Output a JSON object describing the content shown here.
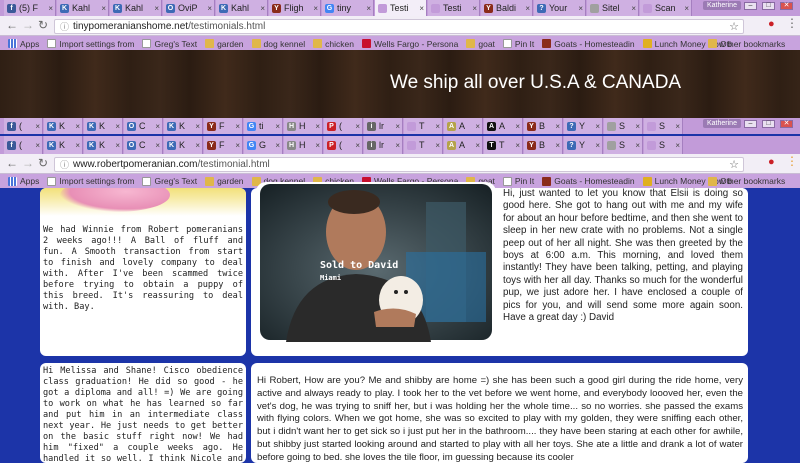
{
  "browser_top": {
    "tabs": [
      {
        "label": "(5) F",
        "color": "#3b5998",
        "glyph": "f"
      },
      {
        "label": "Kahl",
        "color": "#3d6ab5",
        "glyph": "K"
      },
      {
        "label": "Kahl",
        "color": "#3d6ab5",
        "glyph": "K"
      },
      {
        "label": "OviP",
        "color": "#3d6ab5",
        "glyph": "O"
      },
      {
        "label": "Kahl",
        "color": "#3d6ab5",
        "glyph": "K"
      },
      {
        "label": "Fligh",
        "color": "#8a2b1a",
        "glyph": "Y"
      },
      {
        "label": "tiny",
        "color": "#4285f4",
        "glyph": "G"
      },
      {
        "label": "Testi",
        "color": "#c29bd9",
        "glyph": ""
      },
      {
        "label": "Testi",
        "color": "#c29bd9",
        "glyph": ""
      },
      {
        "label": "Baldi",
        "color": "#8a2b1a",
        "glyph": "Y"
      },
      {
        "label": "Your",
        "color": "#3d6ab5",
        "glyph": "?"
      },
      {
        "label": "Sitel",
        "color": "#a0a0a0",
        "glyph": ""
      },
      {
        "label": "Scan",
        "color": "#c29bd9",
        "glyph": ""
      }
    ],
    "profile": "Katherine",
    "url_host": "tinypomeranianshome.net",
    "url_path": "/testimonials.html"
  },
  "browser_inner": {
    "tabs": [
      {
        "label": "( ",
        "color": "#3b5998",
        "glyph": "f"
      },
      {
        "label": "K",
        "color": "#3d6ab5",
        "glyph": "K"
      },
      {
        "label": "K",
        "color": "#3d6ab5",
        "glyph": "K"
      },
      {
        "label": "C",
        "color": "#3d6ab5",
        "glyph": "O"
      },
      {
        "label": "K",
        "color": "#3d6ab5",
        "glyph": "K"
      },
      {
        "label": "F",
        "color": "#8a2b1a",
        "glyph": "Y"
      },
      {
        "label": "ti",
        "color": "#4285f4",
        "glyph": "G"
      },
      {
        "label": "H",
        "color": "#888",
        "glyph": "H"
      },
      {
        "label": "(",
        "color": "#cb2027",
        "glyph": "P"
      },
      {
        "label": "lr",
        "color": "#666",
        "glyph": "i"
      },
      {
        "label": "T",
        "color": "#c29bd9",
        "glyph": ""
      },
      {
        "label": "A",
        "color": "#b5a34a",
        "glyph": "A"
      },
      {
        "label": "A",
        "color": "#111",
        "glyph": "A"
      },
      {
        "label": "B",
        "color": "#8a2b1a",
        "glyph": "Y"
      },
      {
        "label": "Y",
        "color": "#3d6ab5",
        "glyph": "?"
      },
      {
        "label": "S",
        "color": "#a0a0a0",
        "glyph": ""
      },
      {
        "label": "S",
        "color": "#c29bd9",
        "glyph": ""
      }
    ],
    "profile": "Katherine"
  },
  "browser_main": {
    "tabs": [
      {
        "label": "( ",
        "color": "#3b5998",
        "glyph": "f"
      },
      {
        "label": "K",
        "color": "#3d6ab5",
        "glyph": "K"
      },
      {
        "label": "K",
        "color": "#3d6ab5",
        "glyph": "K"
      },
      {
        "label": "C",
        "color": "#3d6ab5",
        "glyph": "O"
      },
      {
        "label": "K",
        "color": "#3d6ab5",
        "glyph": "K"
      },
      {
        "label": "F",
        "color": "#8a2b1a",
        "glyph": "Y"
      },
      {
        "label": "G",
        "color": "#4285f4",
        "glyph": "G"
      },
      {
        "label": "H",
        "color": "#888",
        "glyph": "H"
      },
      {
        "label": "(",
        "color": "#cb2027",
        "glyph": "P"
      },
      {
        "label": "lr",
        "color": "#666",
        "glyph": "i"
      },
      {
        "label": "T",
        "color": "#c29bd9",
        "glyph": ""
      },
      {
        "label": "A",
        "color": "#b5a34a",
        "glyph": "A"
      },
      {
        "label": "T",
        "color": "#111",
        "glyph": "T"
      },
      {
        "label": "B",
        "color": "#8a2b1a",
        "glyph": "Y"
      },
      {
        "label": "Y",
        "color": "#3d6ab5",
        "glyph": "?"
      },
      {
        "label": "S",
        "color": "#a0a0a0",
        "glyph": ""
      },
      {
        "label": "S",
        "color": "#c29bd9",
        "glyph": ""
      }
    ],
    "url_host": "www.robertpomeranian.com",
    "url_path": "/testimonial.html"
  },
  "bookmarks": [
    {
      "label": "Apps",
      "icon": "apps"
    },
    {
      "label": "Import settings from",
      "icon": "doc"
    },
    {
      "label": "Greg's Text",
      "icon": "doc"
    },
    {
      "label": "garden",
      "icon": "folder"
    },
    {
      "label": "dog kennel",
      "icon": "folder"
    },
    {
      "label": "chicken",
      "icon": "folder"
    },
    {
      "label": "Wells Fargo - Persona",
      "icon": "wf"
    },
    {
      "label": "goat",
      "icon": "folder"
    },
    {
      "label": "Pin It",
      "icon": "doc"
    },
    {
      "label": "Goats - Homesteadin",
      "icon": "y"
    },
    {
      "label": "Lunch Money Now b",
      "icon": "star"
    }
  ],
  "other_bookmarks": "Other bookmarks",
  "banner_text": "We ship all over U.S.A & CANADA",
  "testimonials": {
    "winnie": "We had Winnie from Robert pomeranians 2 weeks ago!!! A Ball of fluff and fun. A Smooth transaction from start to finish and lovely company to deal with. After I've been scammed twice before trying to obtain a puppy of this breed. It's reassuring to deal with. Bay.",
    "photo_caption": "Sold to David",
    "photo_location": "Miami",
    "elsii": "Hi, just wanted to let you know that Elsii is doing so good here. She got to hang out with me and my wife for about an hour before bedtime, and then she went to sleep in her new crate with no problems. Not a single peep out of her all night. She was then greeted by the boys at 6:00 a.m. This morning, and loved them instantly! They have been talking, petting, and playing toys with her all day. Thanks so much for the wonderful pup, we just adore her. I have enclosed a couple of pics for you, and will send some more again soon. Have a great day :) David",
    "cisco": "Hi Melissa and Shane! Cisco obedience class graduation! He did so good - he got a diploma and all! =) We are going to work on what he has learned so far and put him in an intermediate class next year. He just needs to get better on the basic stuff right now! We had him \"fixed\" a couple weeks ago. He handled it so well. I think Nicole and I were",
    "shibby": "Hi Robert, How are you? Me and shibby are home =) she has been such a good girl during the ride home, very active and always ready to play. I took her to the vet before we went home, and everybody loooved her, even the vet's dog, he was trying to sniff her, but i was holding her the whole time... so no worries. she passed the exams with flying colors. When we got home, she was so excited to play with my golden, they were sniffing each other, but i didn't want her to get sick so i just put her in the bathroom.... they have been staring at each other for awhile, but shibby just started looking around and started to play with all her toys. She ate a little and drank a lot of water before going to bed. she loves the tile floor, im guessing because its cooler"
  }
}
